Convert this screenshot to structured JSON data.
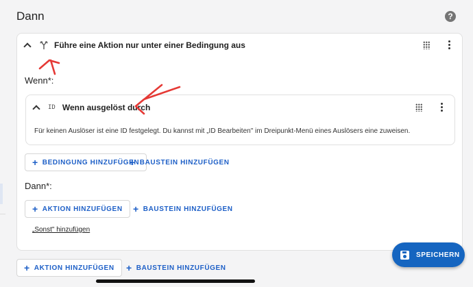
{
  "section": {
    "title": "Dann"
  },
  "help_icon": {
    "glyph": "?"
  },
  "condition_block": {
    "title": "Führe eine Aktion nur unter einer Bedingung aus",
    "icon": "fork-arrows-icon",
    "wenn_label": "Wenn*:",
    "trigger_card": {
      "id_badge": "ID",
      "title": "Wenn ausgelöst durch",
      "description": "Für keinen Auslöser ist eine ID festgelegt. Du kannst mit „ID Bearbeiten\" im Dreipunkt-Menü eines Auslösers eine zuweisen."
    },
    "add_condition_label": "BEDINGUNG HINZUFÜGEN",
    "add_block_label_1": "BAUSTEIN HINZUFÜGEN",
    "dann_label": "Dann*:",
    "add_action_label": "AKTION HINZUFÜGEN",
    "add_block_label_2": "BAUSTEIN HINZUFÜGEN",
    "add_else_link": "„Sonst\" hinzufügen"
  },
  "bottom": {
    "add_action_label": "AKTION HINZUFÜGEN",
    "add_block_label": "BAUSTEIN HINZUFÜGEN"
  },
  "save_button": {
    "label": "SPEICHERN"
  },
  "colors": {
    "accent": "#1565c0",
    "annotation": "#e53935"
  }
}
